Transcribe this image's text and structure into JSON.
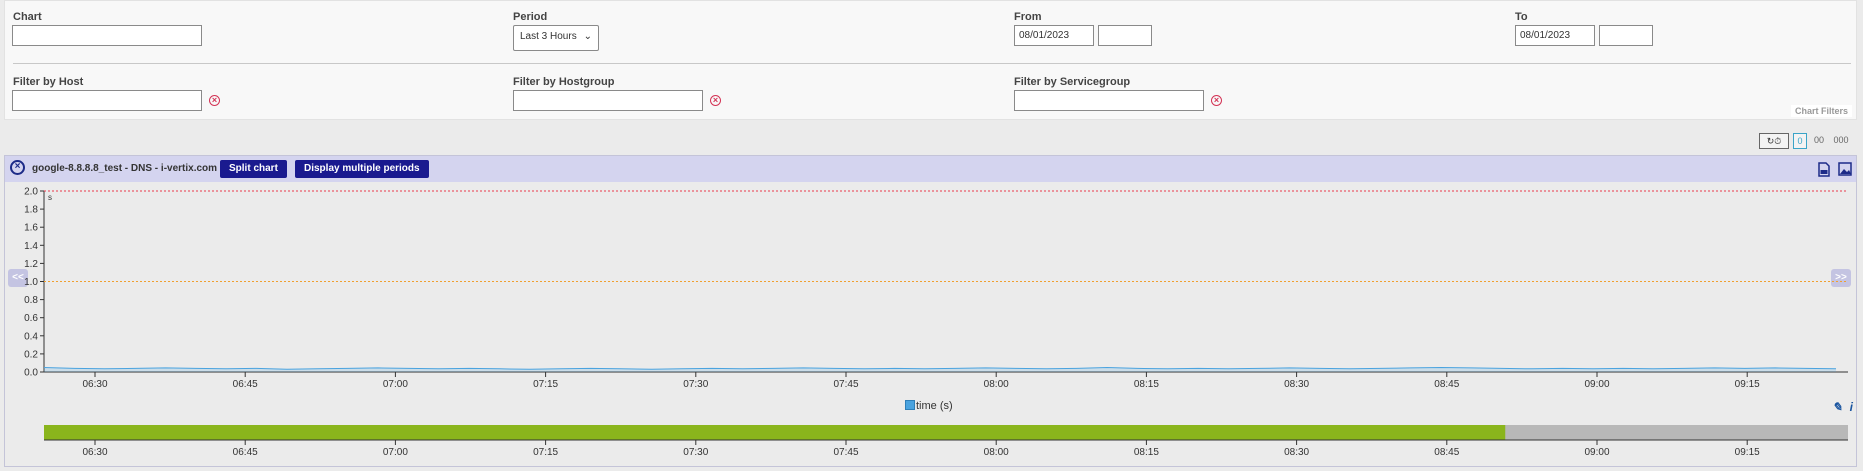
{
  "filters": {
    "chart": {
      "label": "Chart",
      "value": ""
    },
    "period": {
      "label": "Period",
      "value": "Last 3 Hours"
    },
    "from": {
      "label": "From",
      "date": "08/01/2023",
      "time": ""
    },
    "to": {
      "label": "To",
      "date": "08/01/2023",
      "time": ""
    },
    "host": {
      "label": "Filter by Host",
      "value": ""
    },
    "hostgroup": {
      "label": "Filter by Hostgroup",
      "value": ""
    },
    "servicegroup": {
      "label": "Filter by Servicegroup",
      "value": ""
    },
    "chart_filters_label": "Chart Filters"
  },
  "toolbar": {
    "refresh_icon": "refresh-icon",
    "timer_icon": "timer-icon",
    "layout1": "0",
    "layout2": "00",
    "layout3": "000"
  },
  "panel": {
    "title": "google-8.8.8.8_test - DNS - i-vertix.com",
    "split_label": "Split chart",
    "multiple_label": "Display multiple periods",
    "prev_label": "<<",
    "next_label": ">>",
    "legend_label": "time (s)"
  },
  "chart_data": {
    "type": "line",
    "yticks": [
      "0.0",
      "0.2",
      "0.4",
      "0.6",
      "0.8",
      "1.0",
      "1.2",
      "1.4",
      "1.6",
      "1.8",
      "2.0"
    ],
    "ylim": [
      0,
      2.0
    ],
    "y_unit_label": "s",
    "xticks": [
      "06:30",
      "06:45",
      "07:00",
      "07:15",
      "07:30",
      "07:45",
      "08:00",
      "08:15",
      "08:30",
      "08:45",
      "09:00",
      "09:15"
    ],
    "thresholds": [
      {
        "value": 2.0,
        "color": "#e8394b",
        "kind": "critical"
      },
      {
        "value": 1.0,
        "color": "#f0a030",
        "kind": "warning"
      }
    ],
    "series": [
      {
        "name": "time (s)",
        "color": "#4aa3df",
        "values": [
          0.05,
          0.04,
          0.035,
          0.04,
          0.045,
          0.04,
          0.035,
          0.04,
          0.03,
          0.035,
          0.04,
          0.045,
          0.04,
          0.035,
          0.04,
          0.035,
          0.03,
          0.035,
          0.04,
          0.035,
          0.03,
          0.035,
          0.04,
          0.035,
          0.04,
          0.045,
          0.04,
          0.035,
          0.04,
          0.035,
          0.04,
          0.045,
          0.04,
          0.035,
          0.04,
          0.05,
          0.04,
          0.035,
          0.04,
          0.035,
          0.04,
          0.045,
          0.04,
          0.035,
          0.04,
          0.045,
          0.05,
          0.045,
          0.04,
          0.035,
          0.04,
          0.035,
          0.04,
          0.035,
          0.04,
          0.045,
          0.04,
          0.045,
          0.04,
          0.035
        ]
      }
    ],
    "navigator_selected_fraction": 0.81
  },
  "colors": {
    "accent_button": "#1a1a8f",
    "panel_header": "#d4d4ef",
    "navigator_green": "#8ab51c",
    "navigator_grey": "#b8b8b8"
  }
}
